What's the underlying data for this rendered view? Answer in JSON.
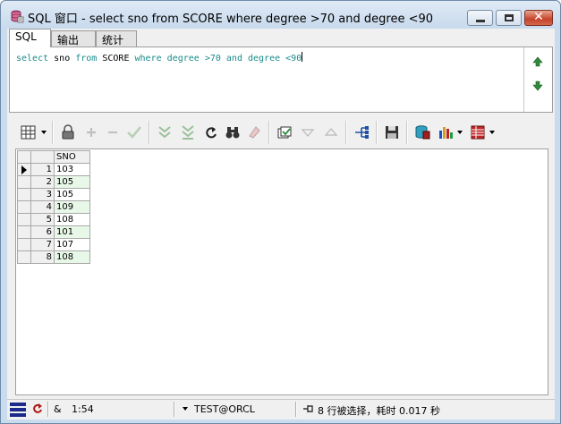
{
  "window": {
    "title": "SQL 窗口 - select sno from SCORE where degree >70 and degree <90"
  },
  "tabs": [
    {
      "label": "SQL"
    },
    {
      "label": "输出"
    },
    {
      "label": "统计"
    }
  ],
  "editor": {
    "tokens": [
      "select",
      "sno",
      "from",
      "SCORE",
      "where",
      "degree",
      ">70",
      "and",
      "degree",
      "<90"
    ]
  },
  "grid": {
    "columns": [
      "SNO"
    ],
    "rows": [
      {
        "num": "1",
        "sno": "103"
      },
      {
        "num": "2",
        "sno": "105"
      },
      {
        "num": "3",
        "sno": "105"
      },
      {
        "num": "4",
        "sno": "109"
      },
      {
        "num": "5",
        "sno": "108"
      },
      {
        "num": "6",
        "sno": "101"
      },
      {
        "num": "7",
        "sno": "107"
      },
      {
        "num": "8",
        "sno": "108"
      }
    ]
  },
  "status": {
    "ampersand": "&",
    "position": "1:54",
    "connection": "TEST@ORCL",
    "message": "8 行被选择，耗时 0.017 秒"
  },
  "colors": {
    "keyword": "#1b8a8a",
    "title_bg": "#c7d9ec",
    "grid_alt_row": "#e8f8e8"
  }
}
